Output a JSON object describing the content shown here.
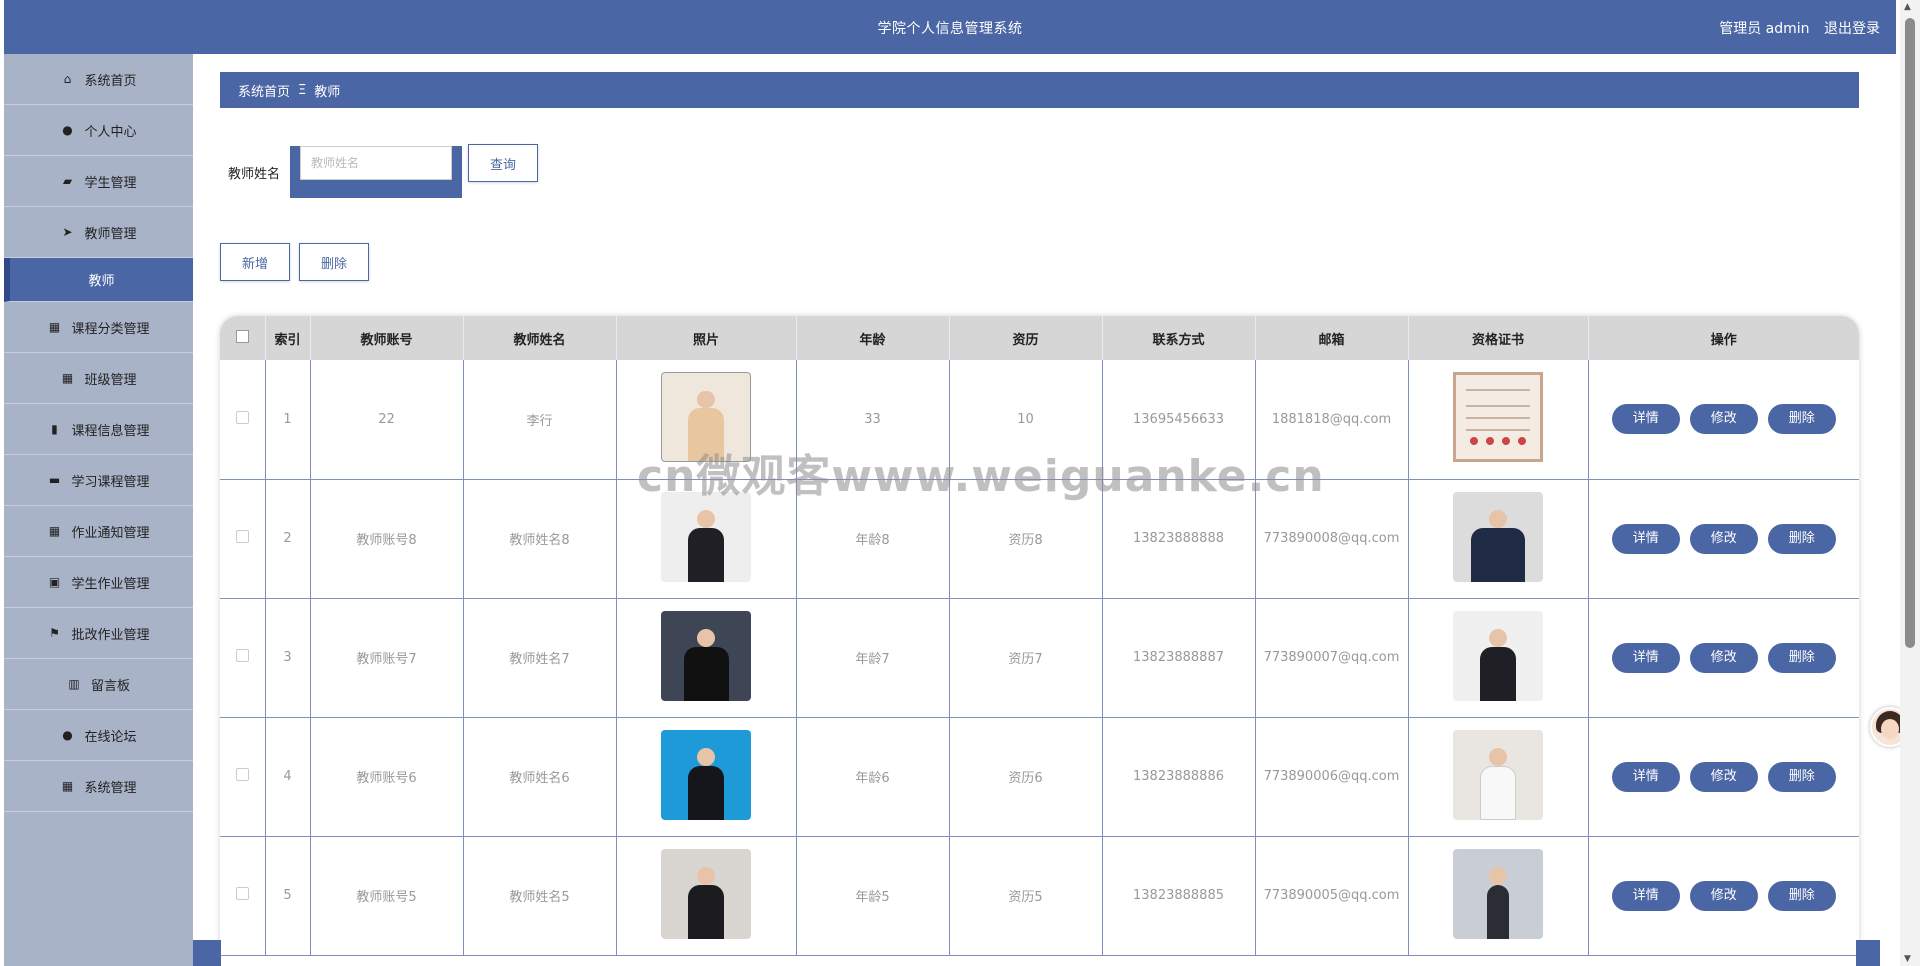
{
  "header": {
    "title": "学院个人信息管理系统",
    "user_label": "管理员 admin",
    "logout": "退出登录"
  },
  "sidebar": {
    "items": [
      {
        "label": "系统首页",
        "icon": "home-icon"
      },
      {
        "label": "个人中心",
        "icon": "user-icon"
      },
      {
        "label": "学生管理",
        "icon": "student-icon"
      },
      {
        "label": "教师管理",
        "icon": "send-icon"
      },
      {
        "label": "教师",
        "icon": ""
      },
      {
        "label": "课程分类管理",
        "icon": "grid-icon"
      },
      {
        "label": "班级管理",
        "icon": "grid-icon"
      },
      {
        "label": "课程信息管理",
        "icon": "bar-chart-icon"
      },
      {
        "label": "学习课程管理",
        "icon": "book-icon"
      },
      {
        "label": "作业通知管理",
        "icon": "grid-icon"
      },
      {
        "label": "学生作业管理",
        "icon": "clipboard-icon"
      },
      {
        "label": "批改作业管理",
        "icon": "flag-icon"
      },
      {
        "label": "留言板",
        "icon": "library-icon"
      },
      {
        "label": "在线论坛",
        "icon": "user-icon"
      },
      {
        "label": "系统管理",
        "icon": "grid-icon"
      }
    ]
  },
  "breadcrumb": {
    "home": "系统首页",
    "separator": "Ξ",
    "current": "教师"
  },
  "search": {
    "label": "教师姓名",
    "placeholder": "教师姓名",
    "button": "查询"
  },
  "actions": {
    "add": "新增",
    "delete": "删除"
  },
  "table": {
    "columns": [
      "索引",
      "教师账号",
      "教师姓名",
      "照片",
      "年龄",
      "资历",
      "联系方式",
      "邮箱",
      "资格证书",
      "操作"
    ],
    "rows": [
      {
        "index": "1",
        "account": "22",
        "name": "李行",
        "age": "33",
        "seniority": "10",
        "phone": "13695456633",
        "email": "1881818@qq.com"
      },
      {
        "index": "2",
        "account": "教师账号8",
        "name": "教师姓名8",
        "age": "年龄8",
        "seniority": "资历8",
        "phone": "13823888888",
        "email": "773890008@qq.com"
      },
      {
        "index": "3",
        "account": "教师账号7",
        "name": "教师姓名7",
        "age": "年龄7",
        "seniority": "资历7",
        "phone": "13823888887",
        "email": "773890007@qq.com"
      },
      {
        "index": "4",
        "account": "教师账号6",
        "name": "教师姓名6",
        "age": "年龄6",
        "seniority": "资历6",
        "phone": "13823888886",
        "email": "773890006@qq.com"
      },
      {
        "index": "5",
        "account": "教师账号5",
        "name": "教师姓名5",
        "age": "年龄5",
        "seniority": "资历5",
        "phone": "13823888885",
        "email": "773890005@qq.com"
      }
    ],
    "row_buttons": {
      "detail": "详情",
      "edit": "修改",
      "delete": "删除"
    }
  },
  "watermark": "cn微观客www.weiguanke.cn",
  "colors": {
    "primary": "#4b66a5",
    "sidebar": "#a9b3c8"
  }
}
